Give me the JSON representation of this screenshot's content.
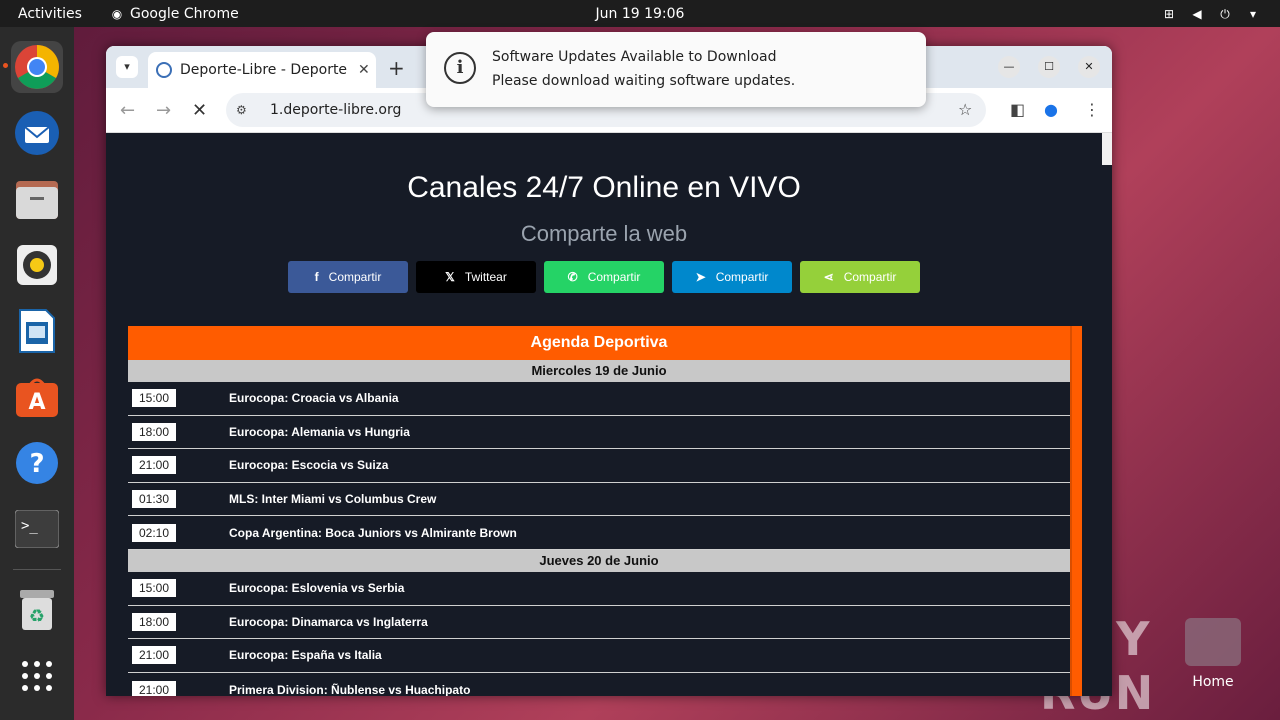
{
  "topbar": {
    "activities": "Activities",
    "app_name": "Google Chrome",
    "clock": "Jun 19  19:06"
  },
  "dock": {
    "items": [
      "chrome-icon",
      "thunderbird-icon",
      "files-icon",
      "rhythmbox-icon",
      "libreoffice-writer-icon",
      "app-center-icon",
      "help-icon",
      "terminal-icon",
      "trash-icon",
      "show-apps-icon"
    ]
  },
  "desktop": {
    "home_label": "Home",
    "watermark": "ANY RUN"
  },
  "notification": {
    "title": "Software Updates Available to Download",
    "body": "Please download waiting software updates."
  },
  "browser": {
    "tab_title": "Deporte-Libre - Deporte",
    "url": "1.deporte-libre.org"
  },
  "page": {
    "heading": "Canales 24/7 Online en VIVO",
    "subheading": "Comparte la web",
    "share_buttons": [
      {
        "label": "Compartir",
        "icon": "f",
        "color": "#3b5998"
      },
      {
        "label": "Twittear",
        "icon": "𝕏",
        "color": "#000000"
      },
      {
        "label": "Compartir",
        "icon": "✆",
        "color": "#25d366"
      },
      {
        "label": "Compartir",
        "icon": "➤",
        "color": "#0088cc"
      },
      {
        "label": "Compartir",
        "icon": "⋖",
        "color": "#95d03a"
      }
    ],
    "agenda_title": "Agenda Deportiva",
    "days": [
      {
        "label": "Miercoles 19 de Junio",
        "events": [
          {
            "time": "15:00",
            "match": "Eurocopa: Croacia vs Albania"
          },
          {
            "time": "18:00",
            "match": "Eurocopa: Alemania vs Hungria"
          },
          {
            "time": "21:00",
            "match": "Eurocopa: Escocia vs Suiza"
          },
          {
            "time": "01:30",
            "match": "MLS: Inter Miami vs Columbus Crew"
          },
          {
            "time": "02:10",
            "match": "Copa Argentina: Boca Juniors vs Almirante Brown"
          }
        ]
      },
      {
        "label": "Jueves 20 de Junio",
        "events": [
          {
            "time": "15:00",
            "match": "Eurocopa: Eslovenia vs Serbia"
          },
          {
            "time": "18:00",
            "match": "Eurocopa: Dinamarca vs Inglaterra"
          },
          {
            "time": "21:00",
            "match": "Eurocopa: España vs Italia"
          },
          {
            "time": "21:00",
            "match": "Primera Division: Ñublense vs Huachipato"
          }
        ]
      }
    ]
  }
}
